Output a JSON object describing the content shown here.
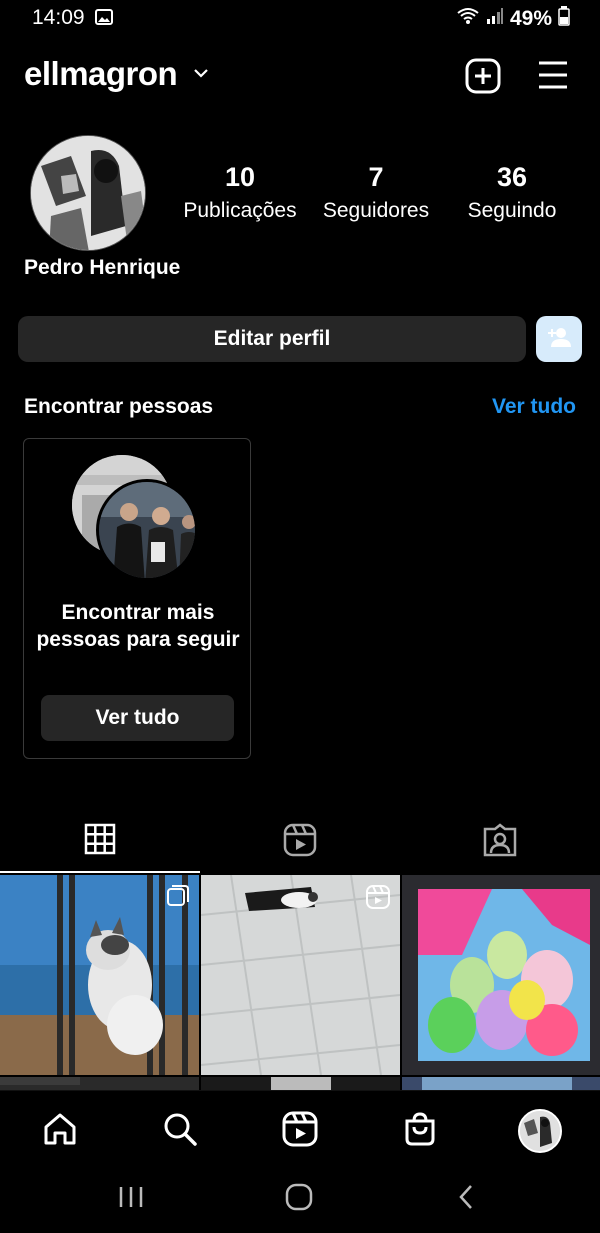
{
  "status_bar": {
    "time": "14:09",
    "battery": "49%"
  },
  "header": {
    "username": "ellmagron"
  },
  "profile": {
    "display_name": "Pedro Henrique",
    "stats": [
      {
        "value": "10",
        "label": "Publicações"
      },
      {
        "value": "7",
        "label": "Seguidores"
      },
      {
        "value": "36",
        "label": "Seguindo"
      }
    ],
    "edit_button": "Editar perfil"
  },
  "discover": {
    "title": "Encontrar pessoas",
    "see_all": "Ver tudo",
    "card": {
      "text": "Encontrar mais pessoas para seguir",
      "button": "Ver tudo"
    }
  },
  "tabs": [
    {
      "name": "grid-icon",
      "active": true
    },
    {
      "name": "reels-icon",
      "active": false
    },
    {
      "name": "tagged-icon",
      "active": false
    }
  ],
  "colors": {
    "background": "#000000",
    "link": "#2196f3",
    "button": "#262626",
    "add_person_bg": "#d7ebfb"
  }
}
